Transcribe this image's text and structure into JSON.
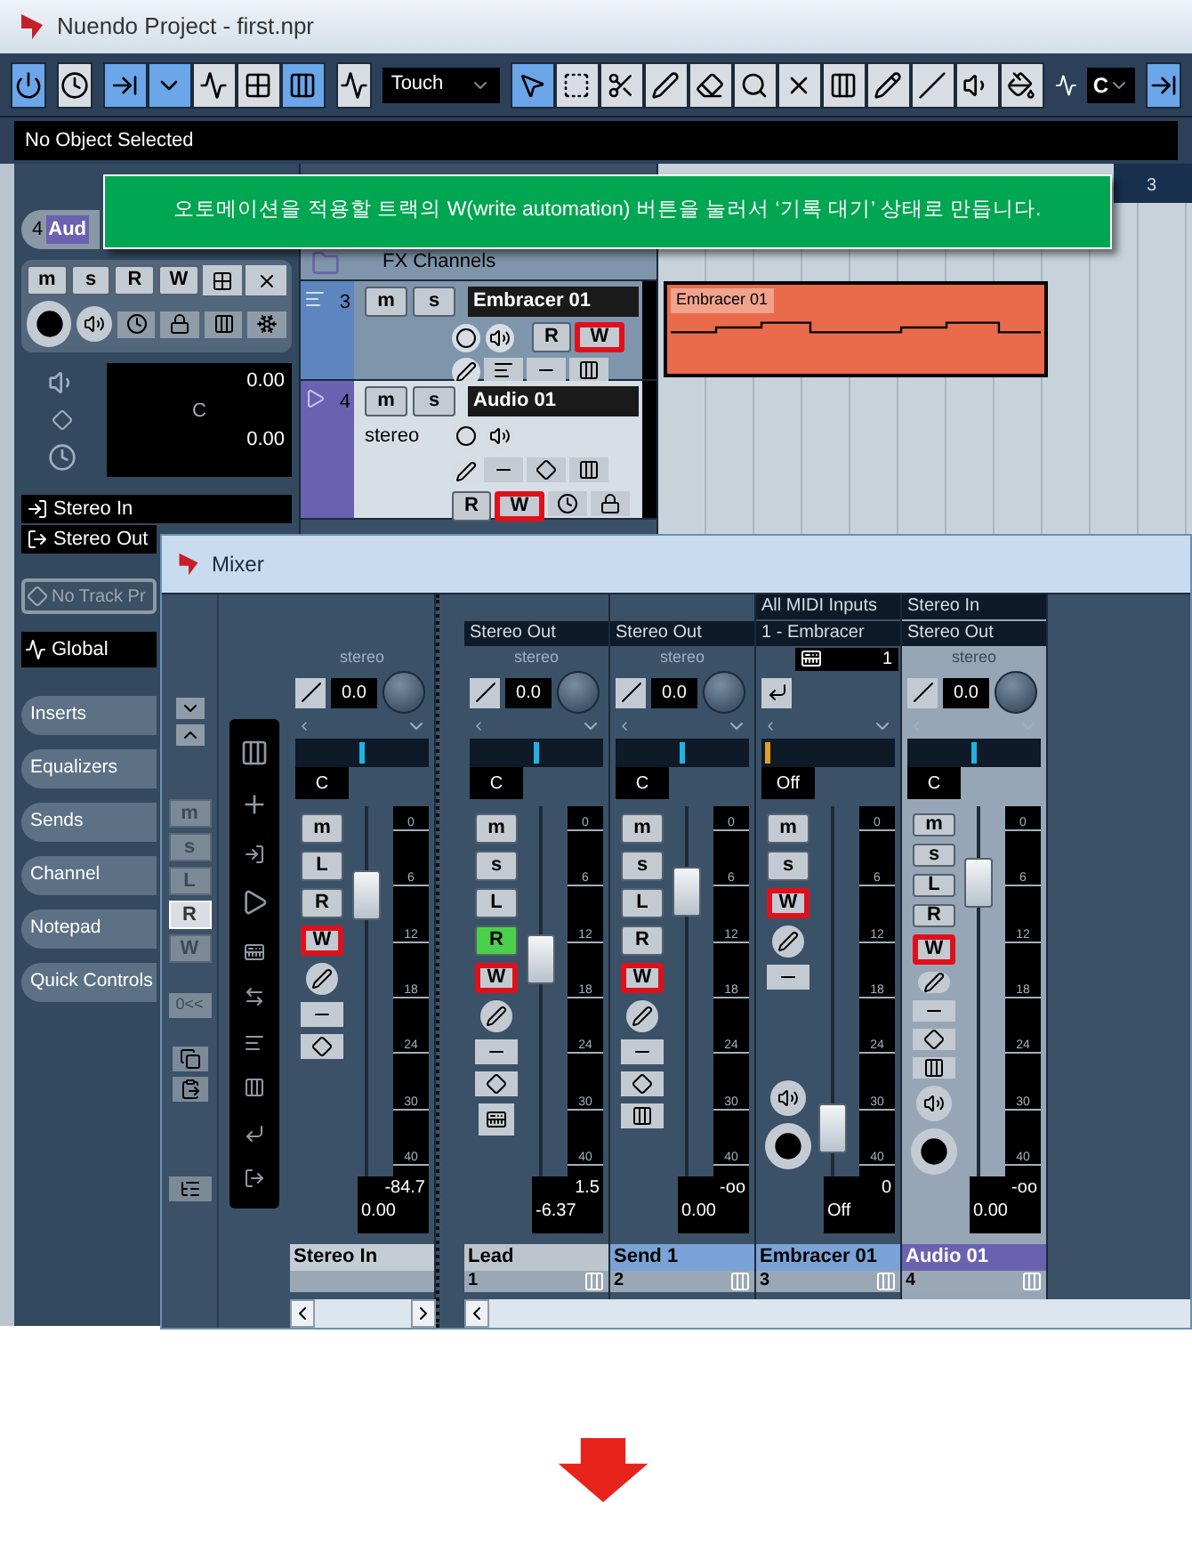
{
  "window": {
    "title": "Nuendo Project - first.npr"
  },
  "toolbar": {
    "automation_mode": "Touch",
    "key": "C"
  },
  "info_line": "No Object Selected",
  "callout": "오토메이션을 적용할 트랙의 W(write automation) 버튼을 눌러서 ‘기록 대기’ 상태로 만듭니다.",
  "inspector": {
    "track_number": "4",
    "track_name": "Aud",
    "buttons": [
      {
        "label": "m"
      },
      {
        "label": "s"
      },
      {
        "label": "R"
      },
      {
        "label": "W"
      }
    ],
    "volume": "0.00",
    "pan": "C",
    "delay": "0.00",
    "input": "Stereo In",
    "output": "Stereo Out",
    "track_preset": "No Track Pr",
    "automation": "Global",
    "sections": [
      "Inserts",
      "Equalizers",
      "Sends",
      "Channel",
      "Notepad",
      "Quick Controls"
    ]
  },
  "track_list": {
    "folder": "FX Channels",
    "tracks": [
      {
        "kind": "fx",
        "number": "3",
        "name": "Embracer 01",
        "selected": false,
        "buttons": [
          {
            "label": "m",
            "highlighted": false
          },
          {
            "label": "s",
            "highlighted": false
          },
          {
            "label": "R",
            "highlighted": false
          },
          {
            "label": "W",
            "highlighted": true
          }
        ]
      },
      {
        "kind": "audio",
        "number": "4",
        "name": "Audio 01",
        "subtitle": "stereo",
        "selected": true,
        "buttons": [
          {
            "label": "m",
            "highlighted": false
          },
          {
            "label": "s",
            "highlighted": false
          },
          {
            "label": "R",
            "highlighted": false
          },
          {
            "label": "W",
            "highlighted": true
          }
        ]
      }
    ]
  },
  "ruler": {
    "bar": "3"
  },
  "event": {
    "name": "Embracer 01"
  },
  "mixer": {
    "title": "Mixer",
    "filters": [
      {
        "label": "m",
        "selected": false
      },
      {
        "label": "s",
        "selected": false
      },
      {
        "label": "L",
        "selected": false
      },
      {
        "label": "R",
        "selected": true
      },
      {
        "label": "W",
        "selected": false
      }
    ],
    "reset_label": "0<<",
    "channels": [
      {
        "kind": "input",
        "format": "stereo",
        "gain": "0.0",
        "pan": "C",
        "level": 0.8,
        "peak": "-84.7",
        "volume": "0.00",
        "name": "Stereo In",
        "color": "#c4cdd6",
        "selected": false,
        "meter_scale": [
          "0",
          "6",
          "12",
          "18",
          "24",
          "30",
          "40"
        ],
        "buttons": [
          {
            "label": "m",
            "on": false,
            "highlighted": false
          },
          {
            "label": "L",
            "on": false,
            "highlighted": false
          },
          {
            "label": "R",
            "on": false,
            "highlighted": false
          },
          {
            "label": "W",
            "on": false,
            "highlighted": true
          }
        ]
      },
      {
        "kind": "instrument",
        "output": "Stereo Out",
        "format": "stereo",
        "gain": "0.0",
        "pan": "C",
        "level": 0.6,
        "peak": "1.5",
        "volume": "-6.37",
        "name": "Lead",
        "number": "1",
        "color": "#bcc4cc",
        "selected": false,
        "meter_scale": [
          "0",
          "6",
          "12",
          "18",
          "24",
          "30",
          "40"
        ],
        "buttons": [
          {
            "label": "m",
            "on": false,
            "highlighted": false
          },
          {
            "label": "s",
            "on": false,
            "highlighted": false
          },
          {
            "label": "L",
            "on": false,
            "highlighted": false
          },
          {
            "label": "R",
            "on": true,
            "highlighted": false
          },
          {
            "label": "W",
            "on": false,
            "highlighted": true
          }
        ]
      },
      {
        "kind": "group",
        "output": "Stereo Out",
        "format": "stereo",
        "gain": "0.0",
        "pan": "C",
        "level": 0.81,
        "peak": "-oo",
        "volume": "0.00",
        "name": "Send 1",
        "number": "2",
        "color": "#7aa2d6",
        "selected": false,
        "meter_scale": [
          "0",
          "6",
          "12",
          "18",
          "24",
          "30",
          "40"
        ],
        "buttons": [
          {
            "label": "m",
            "on": false,
            "highlighted": false
          },
          {
            "label": "s",
            "on": false,
            "highlighted": false
          },
          {
            "label": "L",
            "on": false,
            "highlighted": false
          },
          {
            "label": "R",
            "on": false,
            "highlighted": false
          },
          {
            "label": "W",
            "on": false,
            "highlighted": true
          }
        ]
      },
      {
        "kind": "midi",
        "input": "All MIDI Inputs",
        "output": "1 - Embracer",
        "midi_channel": "1",
        "pan": "Off",
        "level": 0.07,
        "peak": "0",
        "volume": "Off",
        "name": "Embracer 01",
        "number": "3",
        "color": "#7aa2d6",
        "selected": false,
        "meter_scale": [
          "0",
          "6",
          "12",
          "18",
          "24",
          "30",
          "40"
        ],
        "buttons": [
          {
            "label": "m",
            "on": false,
            "highlighted": false
          },
          {
            "label": "s",
            "on": false,
            "highlighted": false
          },
          {
            "label": "W",
            "on": false,
            "highlighted": true
          }
        ]
      },
      {
        "kind": "audio",
        "input": "Stereo In",
        "output": "Stereo Out",
        "format": "stereo",
        "gain": "0.0",
        "pan": "C",
        "level": 0.84,
        "peak": "-oo",
        "volume": "0.00",
        "name": "Audio 01",
        "number": "4",
        "color": "#6a62b0",
        "selected": true,
        "meter_scale": [
          "0",
          "6",
          "12",
          "18",
          "24",
          "30",
          "40"
        ],
        "buttons": [
          {
            "label": "m",
            "on": false,
            "highlighted": false
          },
          {
            "label": "s",
            "on": false,
            "highlighted": false
          },
          {
            "label": "L",
            "on": false,
            "highlighted": false
          },
          {
            "label": "R",
            "on": false,
            "highlighted": false
          },
          {
            "label": "W",
            "on": false,
            "highlighted": true
          }
        ]
      }
    ]
  }
}
